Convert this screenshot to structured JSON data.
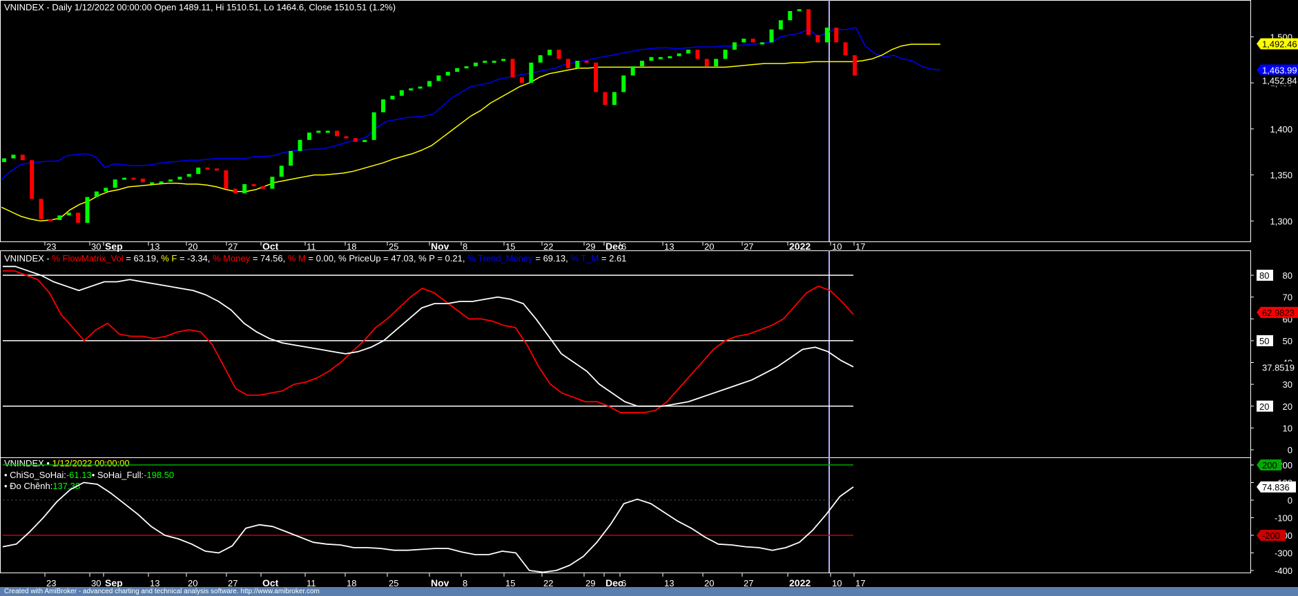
{
  "colors": {
    "background": "#000000",
    "panel_border": "#ffffff",
    "ma_fast": "#0000ff",
    "ma_slow": "#ffff00",
    "candle_up": "#00ff00",
    "candle_down": "#ff0000",
    "cursor": "#b0b0ff",
    "osc_white": "#ffffff",
    "osc_red": "#ff0000",
    "level_red": "#cc0000",
    "level_green": "#00aa00",
    "footer_bg": "#5a7fae"
  },
  "footer": "Created with AmiBroker - advanced charting and technical analysis software. http://www.amibroker.com",
  "chart_data": [
    {
      "type": "candlestick",
      "title_segments": [
        {
          "text": "VNINDEX - Daily 1/12/2022 00:00:00 Open 1489.11, Hi 1510.51, Lo 1464.6, Close 1510.51 (1.2%)",
          "color": "#ffffff"
        }
      ],
      "ylim": [
        1280,
        1540
      ],
      "y_ticks": [
        1300,
        1350,
        1400,
        1450,
        1500
      ],
      "y_tick_labels": [
        "1,300",
        "1,350",
        "1,400",
        "1,450",
        "1,500"
      ],
      "value_labels": [
        {
          "text": "1,492.46",
          "value": 1492.46,
          "bg": "#ffff00",
          "fg": "#000000"
        },
        {
          "text": "1,463.99",
          "value": 1463.99,
          "bg": "#0000ff",
          "fg": "#ffffff"
        },
        {
          "text": "1,452.84",
          "value": 1452.84,
          "bg": "#000000",
          "fg": "#ffffff"
        }
      ],
      "candles_close": [
        1368,
        1372,
        1366,
        1324,
        1302,
        1301,
        1306,
        1309,
        1298,
        1326,
        1332,
        1336,
        1345,
        1347,
        1346,
        1342,
        1342,
        1343,
        1345,
        1348,
        1351,
        1358,
        1357,
        1355,
        1335,
        1330,
        1340,
        1338,
        1335,
        1348,
        1360,
        1376,
        1388,
        1396,
        1398,
        1398,
        1392,
        1390,
        1386,
        1388,
        1418,
        1432,
        1436,
        1442,
        1444,
        1446,
        1452,
        1458,
        1462,
        1466,
        1468,
        1472,
        1474,
        1474,
        1476,
        1456,
        1450,
        1472,
        1480,
        1486,
        1476,
        1466,
        1474,
        1472,
        1440,
        1426,
        1440,
        1458,
        1468,
        1474,
        1478,
        1478,
        1479,
        1482,
        1486,
        1476,
        1468,
        1476,
        1486,
        1494,
        1498,
        1494,
        1494,
        1508,
        1518,
        1528,
        1530,
        1502,
        1494,
        1510,
        1494,
        1480,
        1458
      ],
      "series": [
        {
          "name": "MA fast",
          "color": "#0000ff",
          "values": [
            1345,
            1354,
            1361,
            1363,
            1364,
            1365,
            1365,
            1371,
            1372,
            1373,
            1370,
            1358,
            1362,
            1361,
            1360,
            1360,
            1361,
            1363,
            1364,
            1365,
            1366,
            1366,
            1367,
            1368,
            1368,
            1368,
            1368,
            1370,
            1370,
            1371,
            1374,
            1376,
            1377,
            1378,
            1378,
            1380,
            1383,
            1386,
            1388,
            1392,
            1402,
            1408,
            1410,
            1412,
            1413,
            1414,
            1416,
            1425,
            1434,
            1440,
            1446,
            1448,
            1450,
            1454,
            1456,
            1458,
            1460,
            1462,
            1464,
            1466,
            1470,
            1472,
            1474,
            1476,
            1478,
            1480,
            1482,
            1484,
            1486,
            1487,
            1488,
            1488,
            1487,
            1488,
            1489,
            1489,
            1489,
            1490,
            1490,
            1491,
            1492,
            1493,
            1494,
            1500,
            1502,
            1504,
            1508,
            1500,
            1505,
            1508,
            1508,
            1510,
            1490,
            1482,
            1478,
            1480,
            1476,
            1474,
            1468,
            1465,
            1464
          ]
        },
        {
          "name": "MA slow",
          "color": "#ffff00",
          "values": [
            1315,
            1310,
            1305,
            1302,
            1300,
            1301,
            1303,
            1312,
            1318,
            1322,
            1328,
            1332,
            1334,
            1337,
            1338,
            1339,
            1340,
            1341,
            1341,
            1340,
            1340,
            1339,
            1337,
            1334,
            1332,
            1332,
            1334,
            1338,
            1342,
            1344,
            1346,
            1348,
            1350,
            1350,
            1351,
            1352,
            1354,
            1357,
            1360,
            1363,
            1367,
            1370,
            1373,
            1377,
            1382,
            1390,
            1398,
            1406,
            1414,
            1420,
            1428,
            1434,
            1440,
            1446,
            1450,
            1456,
            1460,
            1462,
            1464,
            1466,
            1466,
            1467,
            1467,
            1467,
            1467,
            1467,
            1467,
            1467,
            1467,
            1467,
            1467,
            1467,
            1467,
            1467,
            1467,
            1468,
            1469,
            1470,
            1471,
            1471,
            1471,
            1472,
            1472,
            1473,
            1473,
            1473,
            1473,
            1473,
            1474,
            1476,
            1480,
            1486,
            1490,
            1492,
            1492,
            1492,
            1492
          ]
        }
      ]
    },
    {
      "type": "line",
      "title_segments": [
        {
          "text": "VNINDEX - ",
          "color": "#ffffff"
        },
        {
          "text": "% FlowMatrix_Vol",
          "color": "#ff0000"
        },
        {
          "text": " = 63.19, ",
          "color": "#ffffff"
        },
        {
          "text": "% F",
          "color": "#ffff00"
        },
        {
          "text": " = -3.34, ",
          "color": "#ffffff"
        },
        {
          "text": "% Money",
          "color": "#ff0000"
        },
        {
          "text": " = 74.56, ",
          "color": "#ffffff"
        },
        {
          "text": "% M",
          "color": "#ff0000"
        },
        {
          "text": " = 0.00, % PriceUp = 47.03, % P = 0.21, ",
          "color": "#ffffff"
        },
        {
          "text": "% Trend_Money",
          "color": "#0000ff"
        },
        {
          "text": " = 69.13, ",
          "color": "#ffffff"
        },
        {
          "text": "% T_M",
          "color": "#0000ff"
        },
        {
          "text": " = 2.61",
          "color": "#ffffff"
        }
      ],
      "ylim": [
        -2,
        90
      ],
      "y_ticks": [
        0,
        10,
        20,
        30,
        40,
        50,
        60,
        70,
        80
      ],
      "y_tick_labels": [
        "0",
        "10",
        "20",
        "30",
        "40",
        "50",
        "60",
        "70",
        "80"
      ],
      "levels": [
        80,
        50,
        20
      ],
      "level_labels": [
        "80",
        "50",
        "20"
      ],
      "value_labels": [
        {
          "text": "62.9823",
          "value": 62.98,
          "bg": "#ff0000",
          "fg": "#000000"
        },
        {
          "text": "37.8519",
          "value": 37.85,
          "bg": "#000000",
          "fg": "#ffffff"
        }
      ],
      "series": [
        {
          "name": "% FlowMatrix_Vol",
          "color": "#ff0000",
          "values": [
            82,
            82,
            80,
            78,
            72,
            62,
            56,
            50,
            55,
            58,
            53,
            52,
            52,
            51,
            52,
            54,
            55,
            54,
            48,
            38,
            28,
            25,
            25,
            26,
            27,
            30,
            31,
            33,
            36,
            40,
            45,
            50,
            56,
            60,
            65,
            70,
            74,
            72,
            68,
            64,
            60,
            60,
            59,
            57,
            56,
            48,
            38,
            30,
            26,
            24,
            22,
            22,
            20,
            17,
            17,
            17,
            18,
            22,
            28,
            34,
            40,
            46,
            50,
            52,
            53,
            55,
            57,
            60,
            66,
            72,
            75,
            73,
            68,
            62
          ]
        },
        {
          "name": "% Trend_Money",
          "color": "#ffffff",
          "values": [
            84,
            84,
            82,
            80,
            77,
            75,
            73,
            75,
            77,
            77,
            78,
            77,
            76,
            75,
            74,
            73,
            71,
            68,
            64,
            58,
            54,
            51,
            49,
            48,
            47,
            46,
            45,
            44,
            45,
            47,
            50,
            55,
            60,
            65,
            67,
            67,
            68,
            68,
            69,
            70,
            69,
            67,
            60,
            52,
            44,
            40,
            36,
            30,
            26,
            22,
            20,
            20,
            20,
            21,
            22,
            24,
            26,
            28,
            30,
            32,
            35,
            38,
            42,
            46,
            47,
            45,
            41,
            38
          ]
        }
      ]
    },
    {
      "type": "line",
      "title_segments": [
        {
          "text": "VNINDEX • ",
          "color": "#ffffff"
        },
        {
          "text": "1/12/2022 00:00:00",
          "color": "#ffff00"
        }
      ],
      "legend_lines": [
        [
          {
            "text": "• ChiSo_SoHai:",
            "color": "#ffffff"
          },
          {
            "text": "-61.13",
            "color": "#00ff00"
          },
          {
            "text": "• SoHai_Full:",
            "color": "#ffffff"
          },
          {
            "text": "-198.50",
            "color": "#00ff00"
          }
        ],
        [
          {
            "text": "• Đo Chênh:",
            "color": "#ffffff"
          },
          {
            "text": "137.38",
            "color": "#00ff00"
          }
        ]
      ],
      "ylim": [
        -430,
        215
      ],
      "y_ticks": [
        -400,
        -300,
        -200,
        -100,
        0,
        100,
        200
      ],
      "y_tick_labels": [
        "-400",
        "-300",
        "-200",
        "-100",
        "0",
        "100",
        "200"
      ],
      "levels": [
        -200,
        200
      ],
      "level_colors": [
        "#cc0000",
        "#00aa00"
      ],
      "value_labels": [
        {
          "text": "200",
          "value": 200,
          "bg": "#00aa00",
          "fg": "#000000"
        },
        {
          "text": "74.836",
          "value": 74.836,
          "bg": "#ffffff",
          "fg": "#000000"
        },
        {
          "text": "-200",
          "value": -200,
          "bg": "#cc0000",
          "fg": "#000000"
        }
      ],
      "series": [
        {
          "name": "Đo Chênh",
          "color": "#ffffff",
          "values": [
            -265,
            -250,
            -180,
            -100,
            -10,
            60,
            100,
            90,
            40,
            -20,
            -80,
            -150,
            -200,
            -220,
            -250,
            -290,
            -300,
            -260,
            -160,
            -140,
            -150,
            -180,
            -210,
            -240,
            -250,
            -255,
            -270,
            -270,
            -275,
            -285,
            -285,
            -280,
            -275,
            -275,
            -295,
            -310,
            -310,
            -290,
            -300,
            -400,
            -410,
            -400,
            -370,
            -320,
            -240,
            -140,
            -20,
            5,
            -20,
            -70,
            -120,
            -160,
            -210,
            -250,
            -255,
            -265,
            -270,
            -285,
            -270,
            -240,
            -170,
            -80,
            20,
            75
          ]
        }
      ]
    }
  ],
  "x_axis": {
    "tick_labels": [
      "23",
      "30",
      "Sep",
      "13",
      "20",
      "27",
      "Oct",
      "11",
      "18",
      "25",
      "Nov",
      "8",
      "15",
      "22",
      "29",
      "Dec",
      "6",
      "13",
      "20",
      "27",
      "2022",
      "10",
      "17"
    ],
    "major_labels": [
      "Sep",
      "Oct",
      "Nov",
      "Dec",
      "2022"
    ]
  }
}
